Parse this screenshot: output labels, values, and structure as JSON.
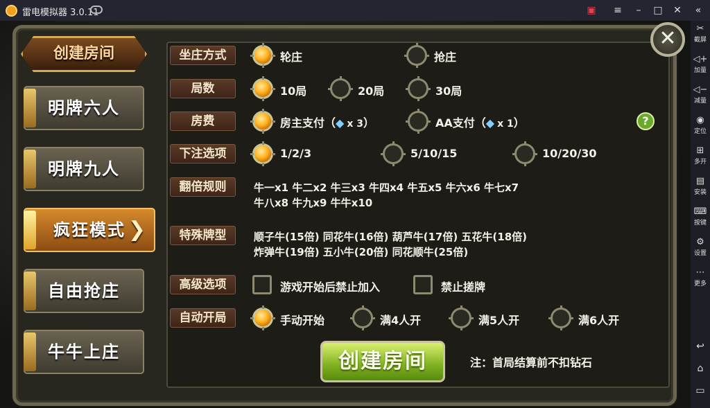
{
  "window": {
    "title": "雷电模拟器 3.0.11",
    "controls": [
      "gift-icon",
      "menu-icon",
      "minimize-icon",
      "maximize-icon",
      "close-icon",
      "back-icon"
    ]
  },
  "emulator_sidebar": {
    "items": [
      {
        "icon": "scissors-icon",
        "label": "截屏"
      },
      {
        "icon": "volume-up-icon",
        "label": "加量"
      },
      {
        "icon": "volume-down-icon",
        "label": "减量"
      },
      {
        "icon": "location-icon",
        "label": "定位"
      },
      {
        "icon": "multi-window-icon",
        "label": "多开"
      },
      {
        "icon": "apk-install-icon",
        "label": "安装"
      },
      {
        "icon": "keyboard-icon",
        "label": "按键"
      },
      {
        "icon": "settings-icon",
        "label": "设置"
      },
      {
        "icon": "more-icon",
        "label": "更多"
      }
    ],
    "nav": [
      "back-nav-icon",
      "home-nav-icon",
      "recent-nav-icon"
    ]
  },
  "header": {
    "title": "创建房间"
  },
  "tabs": [
    {
      "label": "明牌六人",
      "active": false
    },
    {
      "label": "明牌九人",
      "active": false
    },
    {
      "label": "疯狂模式",
      "active": true
    },
    {
      "label": "自由抢庄",
      "active": false
    },
    {
      "label": "牛牛上庄",
      "active": false
    }
  ],
  "options": {
    "banker_mode": {
      "label": "坐庄方式",
      "choices": [
        "轮庄",
        "抢庄"
      ],
      "selected": 0
    },
    "rounds": {
      "label": "局数",
      "choices": [
        "10局",
        "20局",
        "30局"
      ],
      "selected": 0
    },
    "fee": {
      "label": "房费",
      "choices": [
        "房主支付",
        "AA支付"
      ],
      "costs": [
        "x 3",
        "x 1"
      ],
      "selected": 0
    },
    "bet": {
      "label": "下注选项",
      "choices": [
        "1/2/3",
        "5/10/15",
        "10/20/30"
      ],
      "selected": 0
    },
    "double_rules": {
      "label": "翻倍规则",
      "line1": "牛一x1  牛二x2  牛三x3  牛四x4  牛五x5  牛六x6  牛七x7",
      "line2": "牛八x8  牛九x9  牛牛x10"
    },
    "special": {
      "label": "特殊牌型",
      "line1": "顺子牛(15倍)  同花牛(16倍)  葫芦牛(17倍)  五花牛(18倍)",
      "line2": "炸弹牛(19倍)  五小牛(20倍)  同花顺牛(25倍)"
    },
    "advanced": {
      "label": "高级选项",
      "choices": [
        "游戏开始后禁止加入",
        "禁止搓牌"
      ]
    },
    "auto_start": {
      "label": "自动开局",
      "choices": [
        "手动开始",
        "满4人开",
        "满5人开",
        "满6人开"
      ],
      "selected": 0
    }
  },
  "create_button": "创建房间",
  "note": "注：首局结算前不扣钻石",
  "help_icon": "?",
  "close_icon": "✕",
  "gem_icon": "diamond-icon",
  "colors": {
    "accent": "#ffb21e",
    "button": "#7fb020"
  }
}
